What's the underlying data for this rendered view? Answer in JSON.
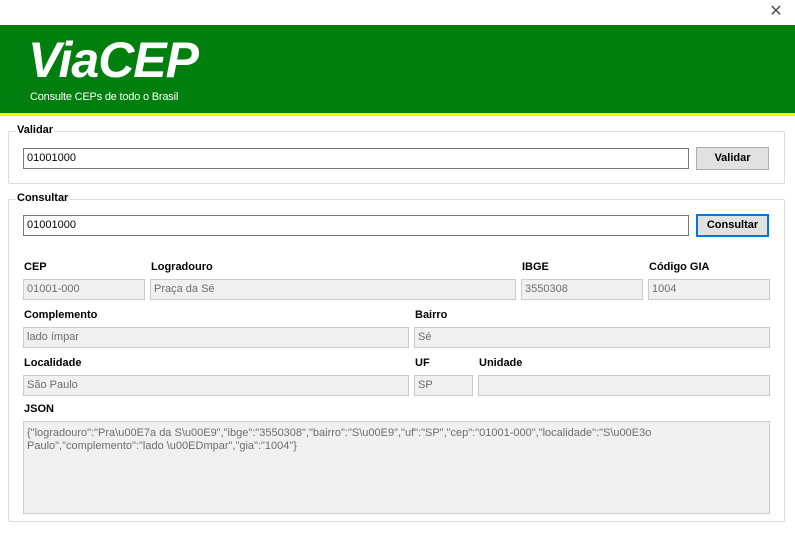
{
  "window": {
    "close_glyph": "✕"
  },
  "banner": {
    "logo_text": "ViaCEP",
    "tagline": "Consulte CEPs de todo o Brasil",
    "colors": {
      "background": "#007f0e",
      "stripe": "#f5f500",
      "logo": "#ffffff"
    }
  },
  "validar": {
    "group_title": "Validar",
    "input_value": "01001000",
    "button_label": "Validar"
  },
  "consultar": {
    "group_title": "Consultar",
    "input_value": "01001000",
    "button_label": "Consultar",
    "fields": {
      "cep": {
        "label": "CEP",
        "value": "01001-000"
      },
      "logradouro": {
        "label": "Logradouro",
        "value": "Praça da Sé"
      },
      "ibge": {
        "label": "IBGE",
        "value": "3550308"
      },
      "gia": {
        "label": "Código GIA",
        "value": "1004"
      },
      "complemento": {
        "label": "Complemento",
        "value": "lado ímpar"
      },
      "bairro": {
        "label": "Bairro",
        "value": "Sé"
      },
      "localidade": {
        "label": "Localidade",
        "value": "São Paulo"
      },
      "uf": {
        "label": "UF",
        "value": "SP"
      },
      "unidade": {
        "label": "Unidade",
        "value": ""
      }
    },
    "json": {
      "label": "JSON",
      "value": "{\"logradouro\":\"Pra\\u00E7a da S\\u00E9\",\"ibge\":\"3550308\",\"bairro\":\"S\\u00E9\",\"uf\":\"SP\",\"cep\":\"01001-000\",\"localidade\":\"S\\u00E3o Paulo\",\"complemento\":\"lado \\u00EDmpar\",\"gia\":\"1004\"}"
    }
  }
}
